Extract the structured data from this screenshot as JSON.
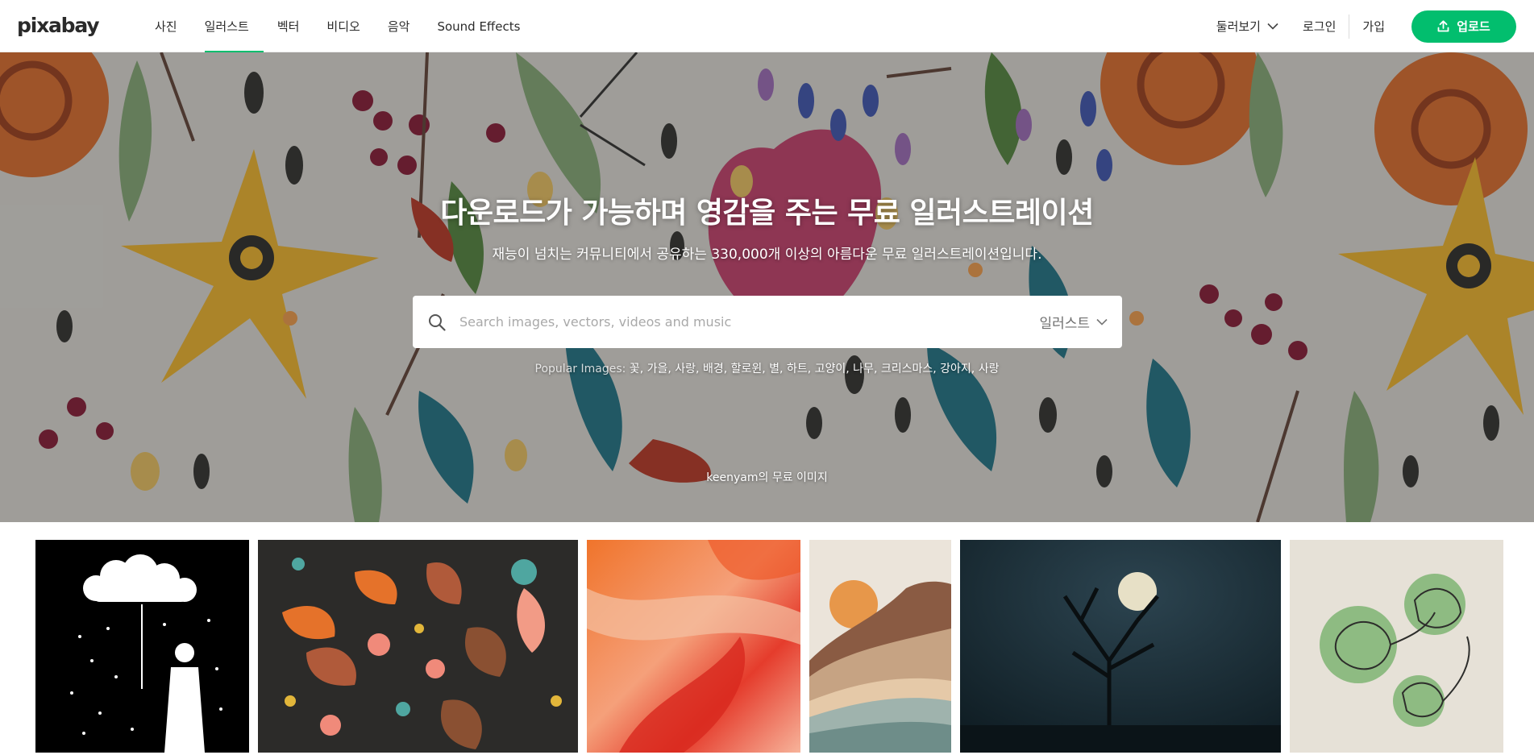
{
  "header": {
    "logo": "pixabay",
    "nav": [
      "사진",
      "일러스트",
      "벡터",
      "비디오",
      "음악",
      "Sound Effects"
    ],
    "active_nav": "일러스트",
    "explore": "둘러보기",
    "login": "로그인",
    "signup": "가입",
    "upload": "업로드"
  },
  "hero": {
    "title": "다운로드가 가능하며 영감을 주는 무료 일러스트레이션",
    "subtitle": "재능이 넘치는 커뮤니티에서 공유하는 330,000개 이상의 아름다운 무료 일러스트레이션입니다.",
    "search_placeholder": "Search images, vectors, videos and music",
    "search_type": "일러스트",
    "popular_label": "Popular Images:",
    "popular_tags": [
      "꽃",
      "가을",
      "사랑",
      "배경",
      "할로윈",
      "별",
      "하트",
      "고양이",
      "나무",
      "크리스마스",
      "강아지",
      "사랑"
    ],
    "credit_user": "keenyam",
    "credit_suffix": "의 무료 이미지"
  },
  "colors": {
    "accent": "#02be6e",
    "header_bg": "#ffffff"
  },
  "icons": [
    "pixabay-logo",
    "chevron-down-icon",
    "upload-icon",
    "search-icon"
  ],
  "grid_tiles": [
    "girl-cloud-umbrella-illustration",
    "autumn-leaves-flowers-illustration",
    "red-orange-abstract-paint",
    "boho-mountains-sun",
    "tree-full-moon-night",
    "monstera-line-art"
  ]
}
